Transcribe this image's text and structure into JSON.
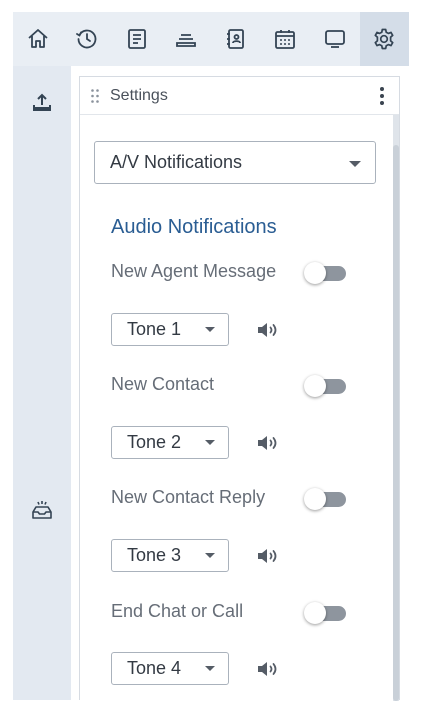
{
  "toolbar": {
    "buttons": [
      {
        "icon": "home-icon"
      },
      {
        "icon": "history-icon"
      },
      {
        "icon": "document-icon"
      },
      {
        "icon": "inbox-tray-icon"
      },
      {
        "icon": "address-book-icon"
      },
      {
        "icon": "calendar-icon"
      },
      {
        "icon": "monitor-icon"
      },
      {
        "icon": "gear-icon",
        "active": true
      }
    ]
  },
  "rail": {
    "items": [
      {
        "icon": "upload-icon"
      },
      {
        "icon": "inbox-icon"
      }
    ]
  },
  "panel": {
    "title": "Settings",
    "category": {
      "selected": "A/V Notifications"
    },
    "section_title": "Audio Notifications",
    "notifications": [
      {
        "label": "New Agent Message",
        "enabled": false,
        "tone": "Tone 1"
      },
      {
        "label": "New Contact",
        "enabled": false,
        "tone": "Tone 2"
      },
      {
        "label": "New Contact Reply",
        "enabled": false,
        "tone": "Tone 3"
      },
      {
        "label": "End Chat or Call",
        "enabled": false,
        "tone": "Tone 4"
      }
    ]
  },
  "colors": {
    "accent": "#2a5d93",
    "toolbar_bg": "#e9eef4",
    "rail_bg": "#e3e9f1",
    "toggle_off": "#8e959e"
  }
}
